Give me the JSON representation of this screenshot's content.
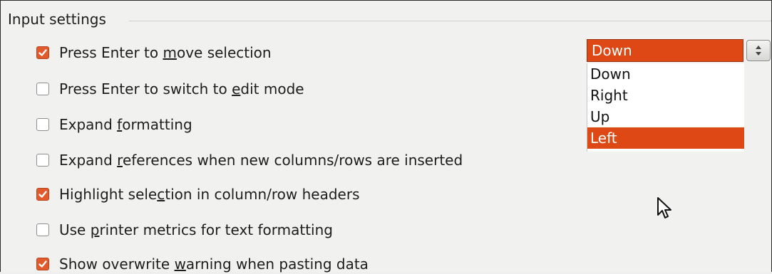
{
  "group": {
    "title": "Input settings"
  },
  "options": [
    {
      "before": "Press Enter to ",
      "mnemonic": "m",
      "after": "ove selection",
      "checked": true
    },
    {
      "before": "Press Enter to switch to ",
      "mnemonic": "e",
      "after": "dit mode",
      "checked": false
    },
    {
      "before": "Expand ",
      "mnemonic": "f",
      "after": "ormatting",
      "checked": false
    },
    {
      "before": "Expand ",
      "mnemonic": "r",
      "after": "eferences when new columns/rows are inserted",
      "checked": false
    },
    {
      "before": "Highlight sele",
      "mnemonic": "c",
      "after": "tion in column/row headers",
      "checked": true
    },
    {
      "before": "Use ",
      "mnemonic": "p",
      "after": "rinter metrics for text formatting",
      "checked": false
    },
    {
      "before": "Show overwrite ",
      "mnemonic": "w",
      "after": "arning when pasting data",
      "checked": true
    }
  ],
  "combo": {
    "value": "Down",
    "options": [
      "Down",
      "Right",
      "Up",
      "Left"
    ],
    "highlighted": "Left"
  },
  "colors": {
    "accent": "#dd4814",
    "checkbox_checked": "#e05a2b",
    "background": "#f1f1ef"
  },
  "icons": {
    "checkmark": "checkmark-icon",
    "spinner": "up-down-arrows-icon",
    "cursor": "mouse-pointer-icon"
  }
}
